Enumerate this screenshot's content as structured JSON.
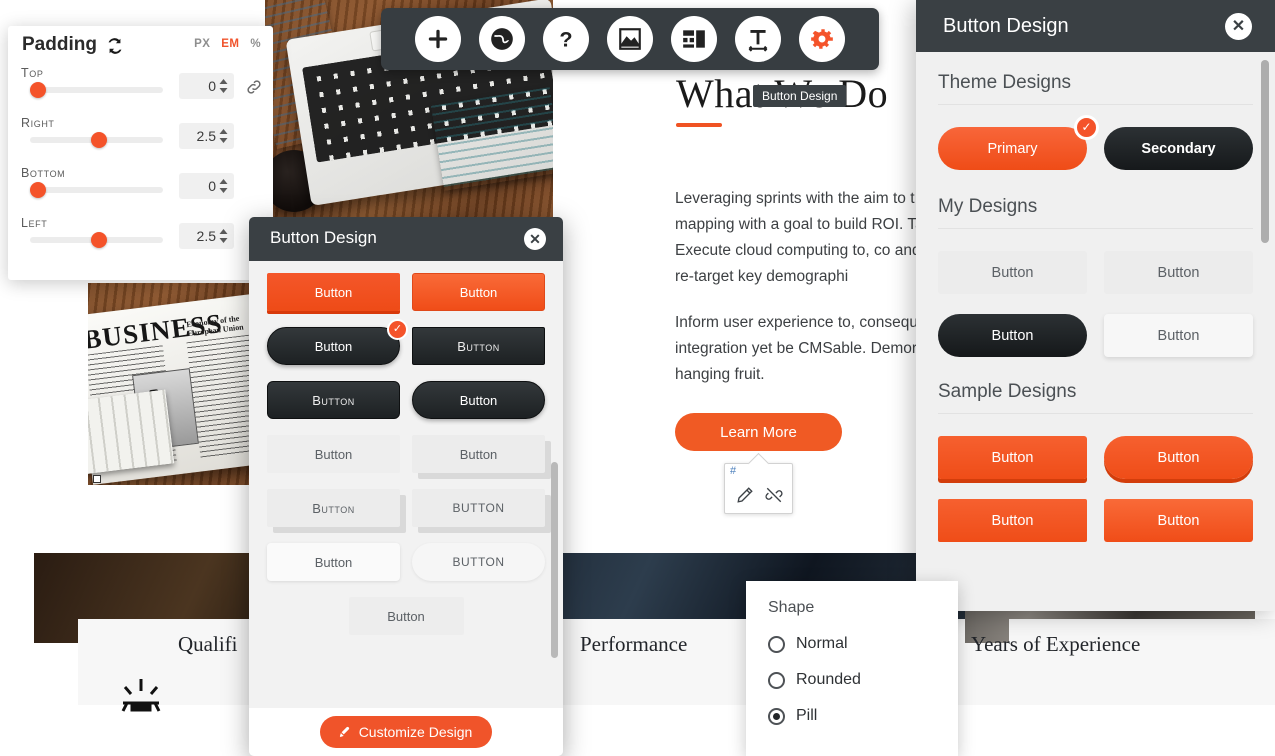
{
  "padding_panel": {
    "title": "Padding",
    "sync_icon": "sync-icon",
    "units": [
      {
        "label": "PX",
        "active": false
      },
      {
        "label": "EM",
        "active": true
      },
      {
        "label": "%",
        "active": false
      }
    ],
    "rows": [
      {
        "label": "Top",
        "value": "0",
        "slider_pct": 4
      },
      {
        "label": "Right",
        "value": "2.5",
        "slider_pct": 48
      },
      {
        "label": "Bottom",
        "value": "0",
        "slider_pct": 4
      },
      {
        "label": "Left",
        "value": "2.5",
        "slider_pct": 48
      }
    ],
    "link_icon": "link-icon"
  },
  "toolbar": {
    "items": [
      {
        "name": "add-icon",
        "glyph": "plus"
      },
      {
        "name": "globe-icon",
        "glyph": "globe"
      },
      {
        "name": "help-icon",
        "glyph": "question"
      },
      {
        "name": "image-icon",
        "glyph": "image"
      },
      {
        "name": "layout-icon",
        "glyph": "layout"
      },
      {
        "name": "text-size-icon",
        "glyph": "text"
      },
      {
        "name": "settings-icon",
        "glyph": "gear"
      }
    ],
    "tooltip": "Button Design"
  },
  "page": {
    "heading": "What We Do",
    "paragraph_1": "Leveraging sprints with the aim to t mapping with a goal to build ROI. Ta box. Execute cloud computing to, co and then re-target key demographi",
    "paragraph_2": "Inform user experience to, consequ integration yet be CMSable. Demor low hanging fruit.",
    "cta_label": "Learn More",
    "edit_popover": {
      "anchor_text": "#",
      "pencil_icon": "pencil-icon",
      "unlink_icon": "unlink-icon"
    },
    "stats": [
      {
        "label": "Qualifi",
        "icon": "award-icon"
      },
      {
        "label": "Performance",
        "icon": "chart-icon"
      },
      {
        "label": "Years of Experience",
        "icon": "clock-icon"
      }
    ]
  },
  "modal_center": {
    "title": "Button Design",
    "close_icon": "close-icon",
    "swatches": [
      {
        "label": "Button",
        "style": "orange-flat",
        "selected": false
      },
      {
        "label": "Button",
        "style": "orange-grad",
        "selected": false
      },
      {
        "label": "Button",
        "style": "dark-pill",
        "selected": true
      },
      {
        "label": "Button",
        "style": "dark-rect sc",
        "selected": false
      },
      {
        "label": "Button",
        "style": "dark-round sc",
        "selected": false
      },
      {
        "label": "Button",
        "style": "dark-pill",
        "selected": false
      },
      {
        "label": "Button",
        "style": "ghost",
        "selected": false
      },
      {
        "label": "Button",
        "style": "ghost-sh",
        "selected": false
      },
      {
        "label": "Button",
        "style": "ghost-sh sc",
        "selected": false
      },
      {
        "label": "Button",
        "style": "ghost-sh up",
        "selected": false
      },
      {
        "label": "Button",
        "style": "light",
        "selected": false
      },
      {
        "label": "Button",
        "style": "light-pill up",
        "selected": false
      }
    ],
    "solo_swatch": {
      "label": "Button",
      "style": "plain"
    },
    "footer_button": "Customize Design",
    "footer_icon": "brush-icon"
  },
  "panel_right": {
    "title": "Button Design",
    "close_icon": "close-icon",
    "sections": [
      {
        "heading": "Theme Designs",
        "swatches": [
          {
            "label": "Primary",
            "style": "primary",
            "selected": true
          },
          {
            "label": "Secondary",
            "style": "secondary",
            "selected": false
          }
        ]
      },
      {
        "heading": "My Designs",
        "swatches": [
          {
            "label": "Button",
            "style": "ghost",
            "selected": false
          },
          {
            "label": "Button",
            "style": "ghost",
            "selected": false
          },
          {
            "label": "Button",
            "style": "dark-pill",
            "selected": false
          },
          {
            "label": "Button",
            "style": "light-card",
            "selected": false
          }
        ]
      },
      {
        "heading": "Sample Designs",
        "swatches": [
          {
            "label": "Button",
            "style": "or-flat",
            "selected": false
          },
          {
            "label": "Button",
            "style": "or-pill",
            "selected": false
          },
          {
            "label": "Button",
            "style": "or-rect",
            "selected": false
          },
          {
            "label": "Button",
            "style": "or-rect2",
            "selected": false
          }
        ]
      }
    ]
  },
  "shape_dropdown": {
    "title": "Shape",
    "options": [
      {
        "label": "Normal",
        "selected": false
      },
      {
        "label": "Rounded",
        "selected": false
      },
      {
        "label": "Pill",
        "selected": true
      }
    ]
  },
  "colors": {
    "accent_orange": "#f0542a",
    "dark_chrome": "#3a4044",
    "panel_gray": "#f0f0f0"
  }
}
